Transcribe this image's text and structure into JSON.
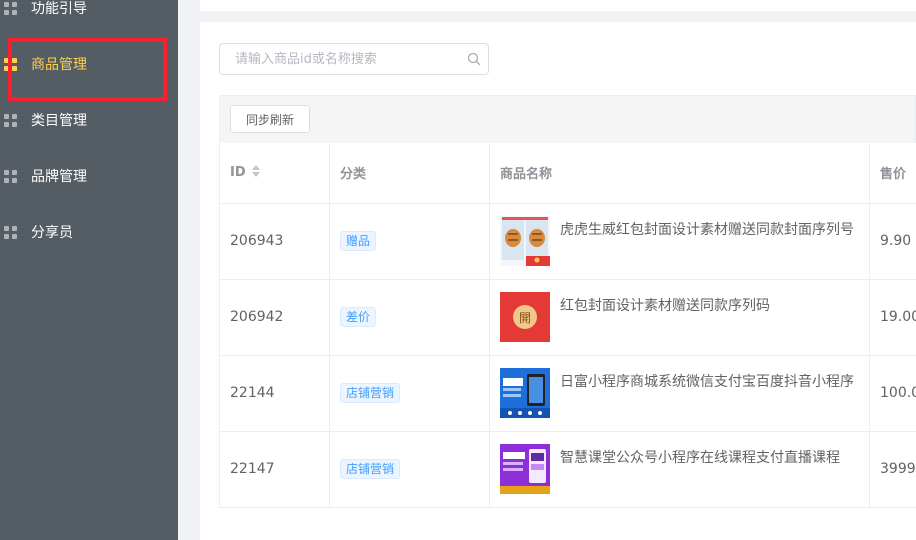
{
  "sidebar": {
    "items": [
      {
        "label": "功能引导",
        "active": false
      },
      {
        "label": "商品管理",
        "active": true
      },
      {
        "label": "类目管理",
        "active": false
      },
      {
        "label": "品牌管理",
        "active": false
      },
      {
        "label": "分享员",
        "active": false
      }
    ]
  },
  "search": {
    "placeholder": "请输入商品id或名称搜索"
  },
  "toolbar": {
    "sync_label": "同步刷新"
  },
  "table": {
    "columns": [
      "ID",
      "分类",
      "商品名称",
      "售价"
    ],
    "rows": [
      {
        "id": "206943",
        "category": "赠品",
        "name": "虎虎生威红包封面设计素材赠送同款封面序列号",
        "price": "9.90",
        "thumb": "tiger-red-envelope"
      },
      {
        "id": "206942",
        "category": "差价",
        "name": "红包封面设计素材赠送同款序列码",
        "price": "19.00",
        "thumb": "red-envelope"
      },
      {
        "id": "22144",
        "category": "店铺营销",
        "name": "日富小程序商城系统微信支付宝百度抖音小程序",
        "price": "100.0",
        "thumb": "blue-miniapp"
      },
      {
        "id": "22147",
        "category": "店铺营销",
        "name": "智慧课堂公众号小程序在线课程支付直播课程",
        "price": "3999.",
        "thumb": "purple-classroom"
      }
    ]
  },
  "thumb_open_char": "開",
  "colors": {
    "sidebar_bg": "#545c64",
    "active": "#ffd04b",
    "highlight": "#f5222d",
    "tag_blue": "#409eff"
  }
}
